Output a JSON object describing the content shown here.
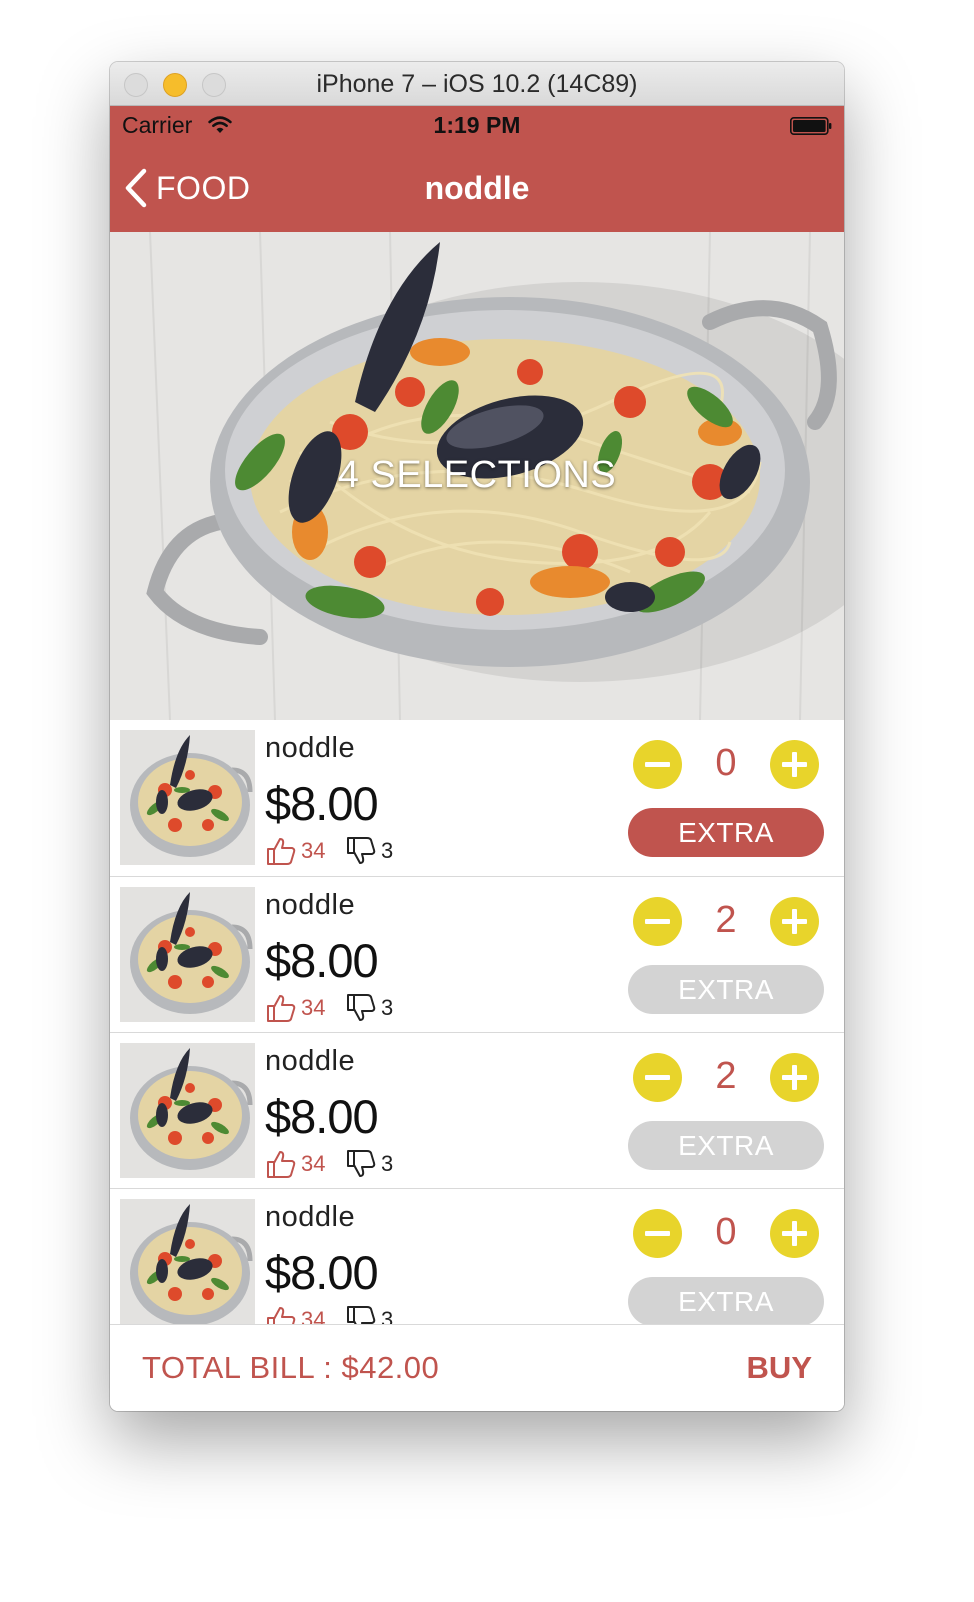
{
  "window": {
    "title": "iPhone 7 – iOS 10.2 (14C89)"
  },
  "status_bar": {
    "carrier": "Carrier",
    "time": "1:19 PM"
  },
  "nav": {
    "back_label": "FOOD",
    "title": "noddle"
  },
  "hero": {
    "overlay_text": "4 SELECTIONS"
  },
  "items": [
    {
      "name": "noddle",
      "price": "$8.00",
      "likes": "34",
      "dislikes": "3",
      "quantity": "0",
      "extra_label": "EXTRA",
      "extra_active": true
    },
    {
      "name": "noddle",
      "price": "$8.00",
      "likes": "34",
      "dislikes": "3",
      "quantity": "2",
      "extra_label": "EXTRA",
      "extra_active": false
    },
    {
      "name": "noddle",
      "price": "$8.00",
      "likes": "34",
      "dislikes": "3",
      "quantity": "2",
      "extra_label": "EXTRA",
      "extra_active": false
    },
    {
      "name": "noddle",
      "price": "$8.00",
      "likes": "34",
      "dislikes": "3",
      "quantity": "0",
      "extra_label": "EXTRA",
      "extra_active": false
    }
  ],
  "footer": {
    "total_label": "TOTAL BILL : $42.00",
    "buy_label": "BUY"
  },
  "colors": {
    "brand": "#c0544e",
    "accent": "#e8d42b",
    "disabled": "#d3d3d3"
  },
  "icons": {
    "back": "chevron-left-icon",
    "like": "thumbs-up-icon",
    "dislike": "thumbs-down-icon",
    "minus": "minus-circle-icon",
    "plus": "plus-circle-icon"
  }
}
